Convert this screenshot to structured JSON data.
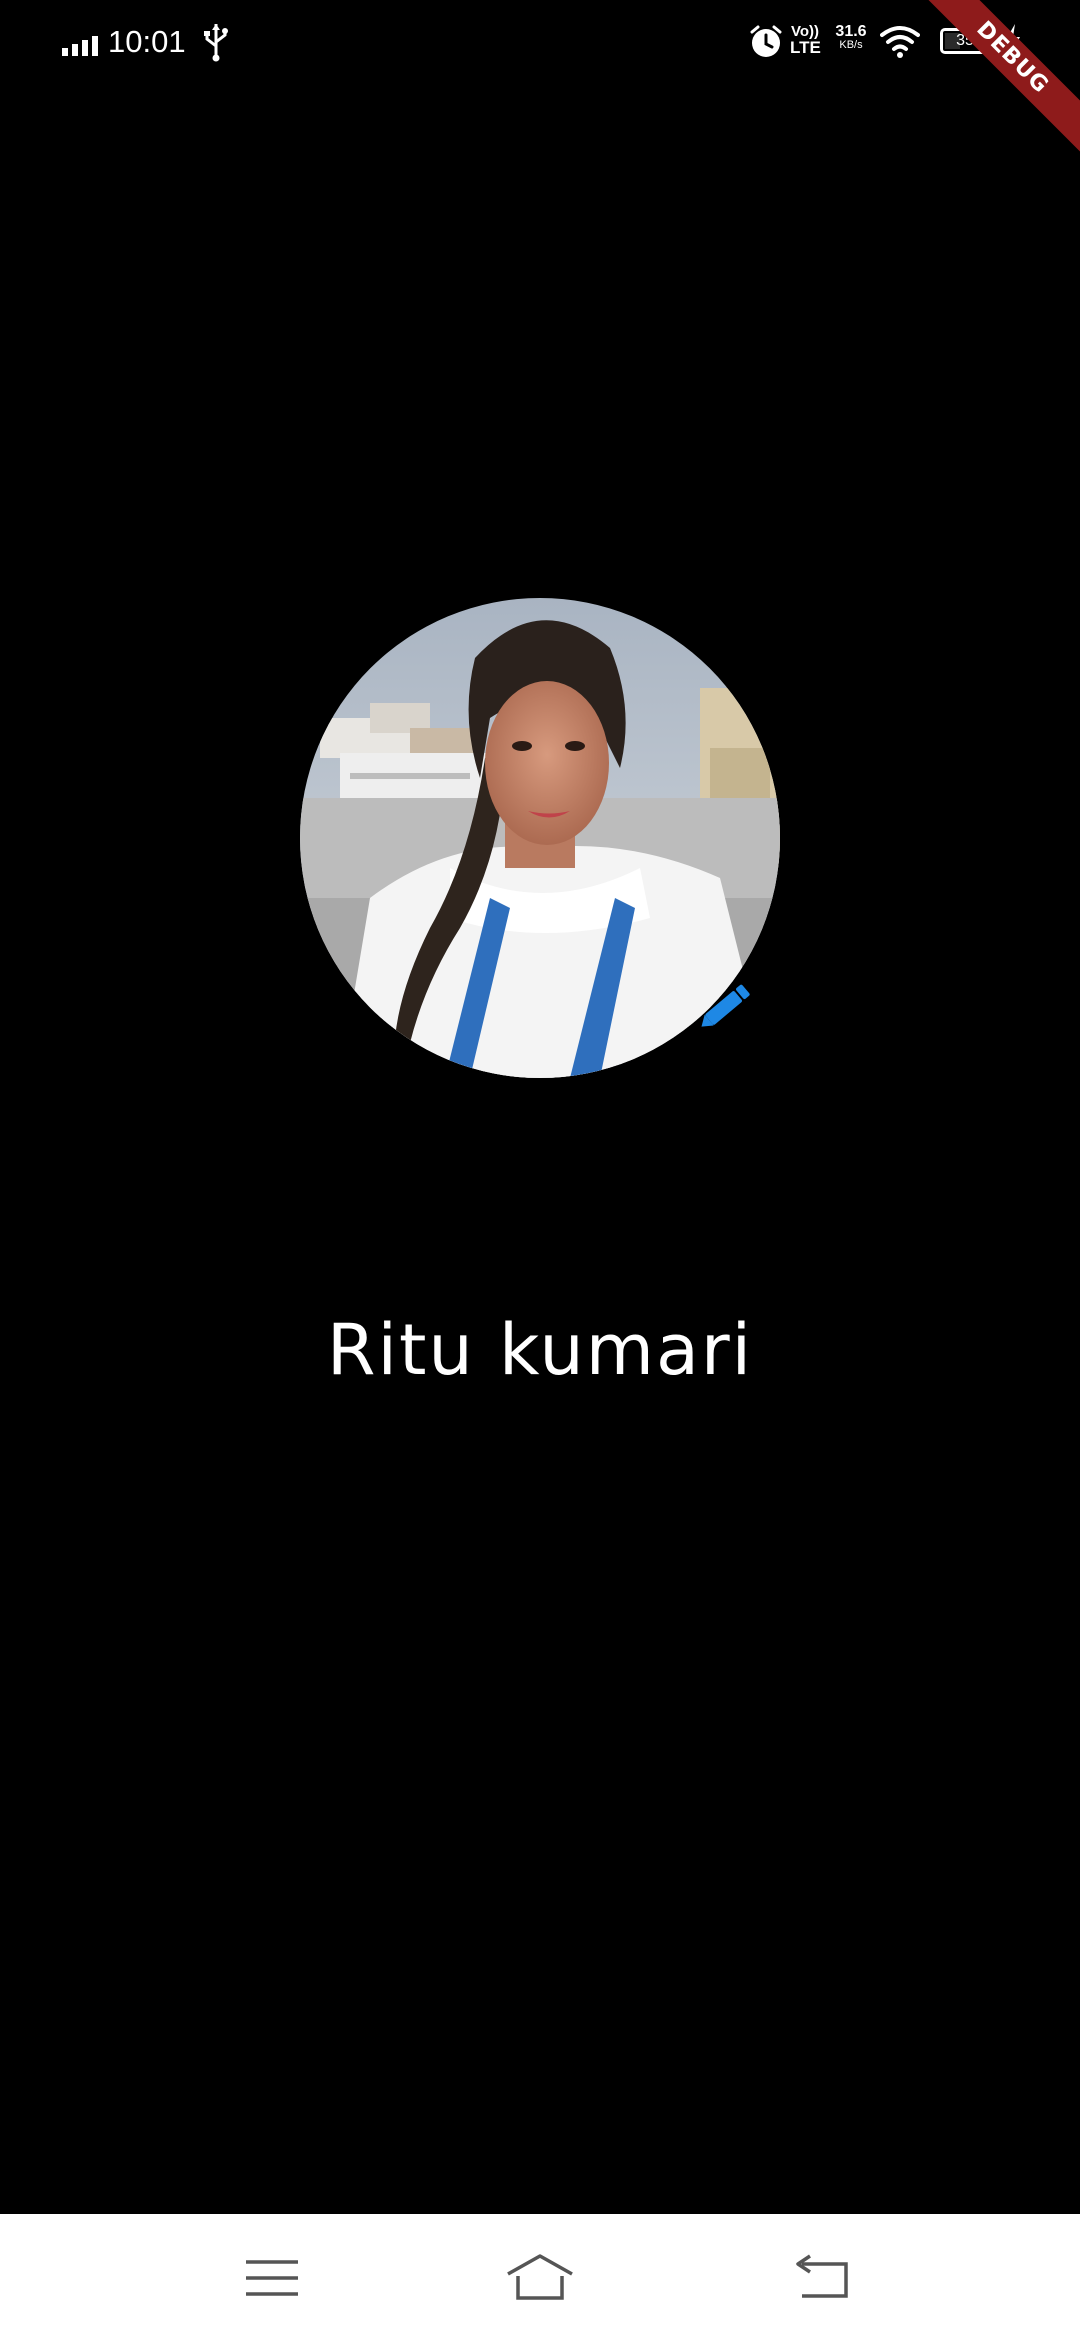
{
  "status_bar": {
    "time": "10:01",
    "network_type_top": "Vo))",
    "network_type_bottom": "LTE",
    "speed_value": "31.6",
    "speed_unit": "KB/s",
    "battery_percent": "35",
    "icons": [
      "signal-icon",
      "usb-icon",
      "alarm-icon",
      "wifi-icon",
      "battery-icon",
      "charging-icon"
    ]
  },
  "debug_banner": {
    "label": "DEBUG",
    "color": "#8e1b1b"
  },
  "profile": {
    "name": "Ritu kumari",
    "photo_icon": "profile-photo",
    "edit_icon": "pencil-icon",
    "accent_color": "#1e88e5"
  },
  "nav_bar": {
    "items": [
      "menu-icon",
      "home-icon",
      "back-icon"
    ]
  }
}
